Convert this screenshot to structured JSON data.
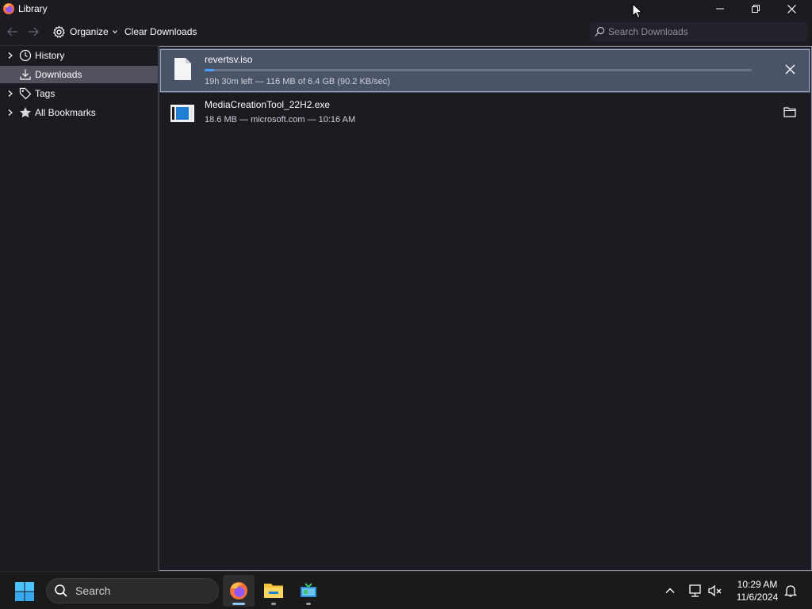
{
  "window": {
    "title": "Library",
    "controls": [
      "minimize",
      "maximize",
      "close"
    ]
  },
  "toolbar": {
    "back_icon": "back-arrow-icon",
    "forward_icon": "forward-arrow-icon",
    "organize_label": "Organize",
    "clear_downloads_label": "Clear Downloads",
    "search_placeholder": "Search Downloads"
  },
  "sidebar": {
    "items": [
      {
        "label": "History",
        "icon": "clock-icon",
        "expandable": true,
        "selected": false
      },
      {
        "label": "Downloads",
        "icon": "download-icon",
        "expandable": false,
        "selected": true
      },
      {
        "label": "Tags",
        "icon": "tag-icon",
        "expandable": true,
        "selected": false
      },
      {
        "label": "All Bookmarks",
        "icon": "star-icon",
        "expandable": true,
        "selected": false
      }
    ]
  },
  "downloads": [
    {
      "name": "revertsv.iso",
      "status": "19h 30m left — 116 MB of 6.4 GB (90.2 KB/sec)",
      "progress": 0.018,
      "in_progress": true,
      "action_icon": "cancel-x-icon",
      "file_icon": "generic-file-icon",
      "selected": true
    },
    {
      "name": "MediaCreationTool_22H2.exe",
      "status": "18.6 MB — microsoft.com — 10:16 AM",
      "in_progress": false,
      "action_icon": "folder-icon",
      "file_icon": "windows-installer-icon",
      "selected": false
    }
  ],
  "taskbar": {
    "search_label": "Search",
    "apps": [
      {
        "name": "Firefox",
        "icon": "firefox-icon",
        "active": true
      },
      {
        "name": "File Explorer",
        "icon": "file-explorer-icon",
        "active": false
      },
      {
        "name": "Media Creation Tool",
        "icon": "media-creation-tool-icon",
        "active": false
      }
    ],
    "clock": {
      "time": "10:29 AM",
      "date": "11/6/2024"
    }
  },
  "colors": {
    "background": "#1c1b22",
    "selected_sidebar": "#52525e",
    "selected_row": "#4a5468",
    "progress": "#4a9eff",
    "taskbar": "#1a1a1a"
  }
}
